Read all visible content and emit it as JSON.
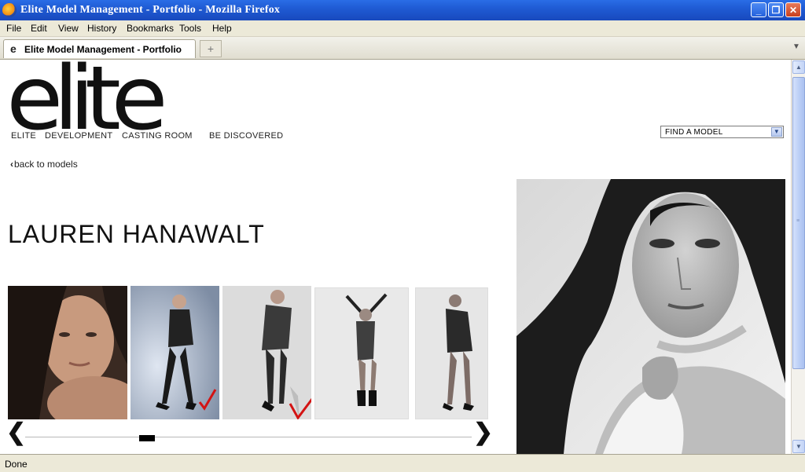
{
  "window": {
    "title": "Elite Model Management - Portfolio - Mozilla Firefox",
    "min_icon": "_",
    "max_icon": "❐",
    "close_icon": "✕"
  },
  "menu": {
    "file": "File",
    "edit": "Edit",
    "view": "View",
    "history": "History",
    "bookmarks": "Bookmarks",
    "tools": "Tools",
    "help": "Help"
  },
  "tab": {
    "label": "Elite Model Management - Portfolio",
    "icon": "e",
    "new_tab_icon": "+"
  },
  "site": {
    "logo": "elite",
    "nav": [
      "ELITE",
      "DEVELOPMENT",
      "CASTING ROOM",
      "BE DISCOVERED"
    ],
    "find_model": "FIND A MODEL",
    "back_link": "back to models",
    "model_name": "LAUREN HANAWALT"
  },
  "gallery": {
    "prev_arrow": "❮",
    "next_arrow": "❯",
    "thumbnails": [
      {
        "desc": "portrait close-up, dark hair",
        "checked": false
      },
      {
        "desc": "full body pose, dark backdrop",
        "checked": true
      },
      {
        "desc": "full body pose, grey backdrop",
        "checked": true
      },
      {
        "desc": "full body pose, arms raised",
        "checked": false
      },
      {
        "desc": "full body pose, jacket",
        "checked": false
      }
    ]
  },
  "status": {
    "text": "Done"
  }
}
